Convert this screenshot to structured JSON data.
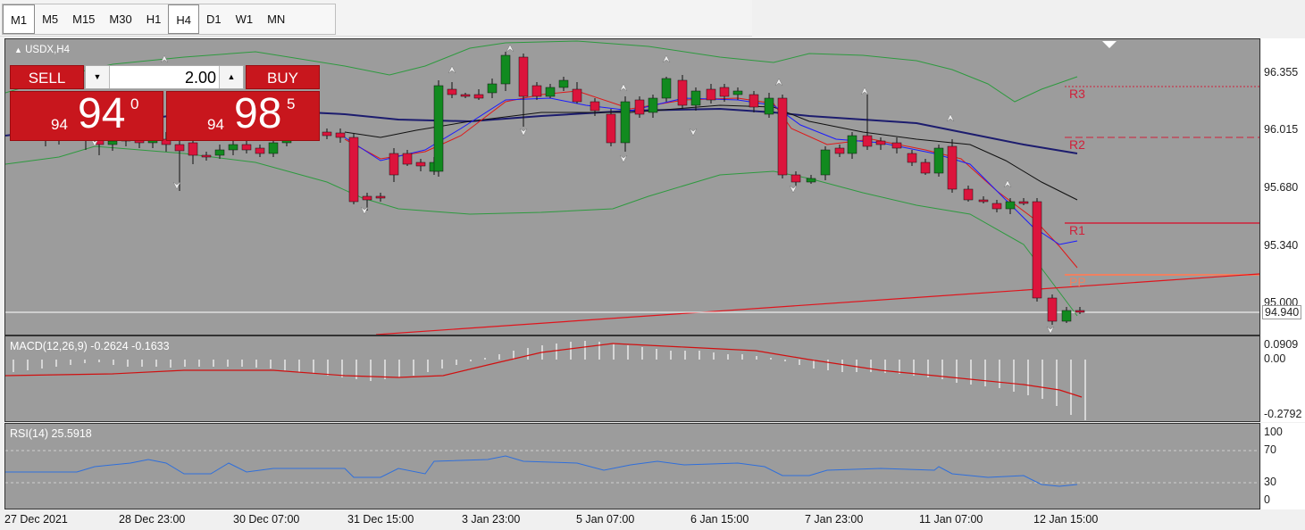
{
  "timeframes": [
    "M1",
    "M5",
    "M15",
    "M30",
    "H1",
    "H4",
    "D1",
    "W1",
    "MN"
  ],
  "active_timeframe": "H4",
  "chart": {
    "title": "USDX,H4",
    "price_labels": [
      "96.355",
      "96.015",
      "95.680",
      "95.340",
      "95.000"
    ],
    "current_price_tag": "94.940",
    "pivot_labels": [
      "R3",
      "R2",
      "R1",
      "PP"
    ],
    "colors": {
      "up": "#118a1f",
      "down": "#dc143c",
      "ma_fast": "#1a1aff",
      "ma_mid": "#e01818",
      "ma_slow": "#101010",
      "ma_long": "#1c1c6e",
      "bands": "#2e9a3f",
      "pivot": "#d0203a",
      "pp": "#f08060"
    }
  },
  "trade_panel": {
    "sell_label": "SELL",
    "buy_label": "BUY",
    "lot_size": "2.00",
    "sell_small": "94",
    "sell_big": "94",
    "sell_sup": "0",
    "buy_small": "94",
    "buy_big": "98",
    "buy_sup": "5"
  },
  "macd": {
    "title": "MACD(12,26,9) -0.2624 -0.1633",
    "axis_labels": [
      "0.0909",
      "0.00",
      "-0.2792"
    ]
  },
  "rsi": {
    "title": "RSI(14) 25.5918",
    "axis_labels": [
      "100",
      "70",
      "30",
      "0"
    ]
  },
  "dates": [
    "27 Dec 2021",
    "28 Dec 23:00",
    "30 Dec 07:00",
    "31 Dec 15:00",
    "3 Jan 23:00",
    "5 Jan 07:00",
    "6 Jan 15:00",
    "7 Jan 23:00",
    "11 Jan 07:00",
    "12 Jan 15:00"
  ]
}
